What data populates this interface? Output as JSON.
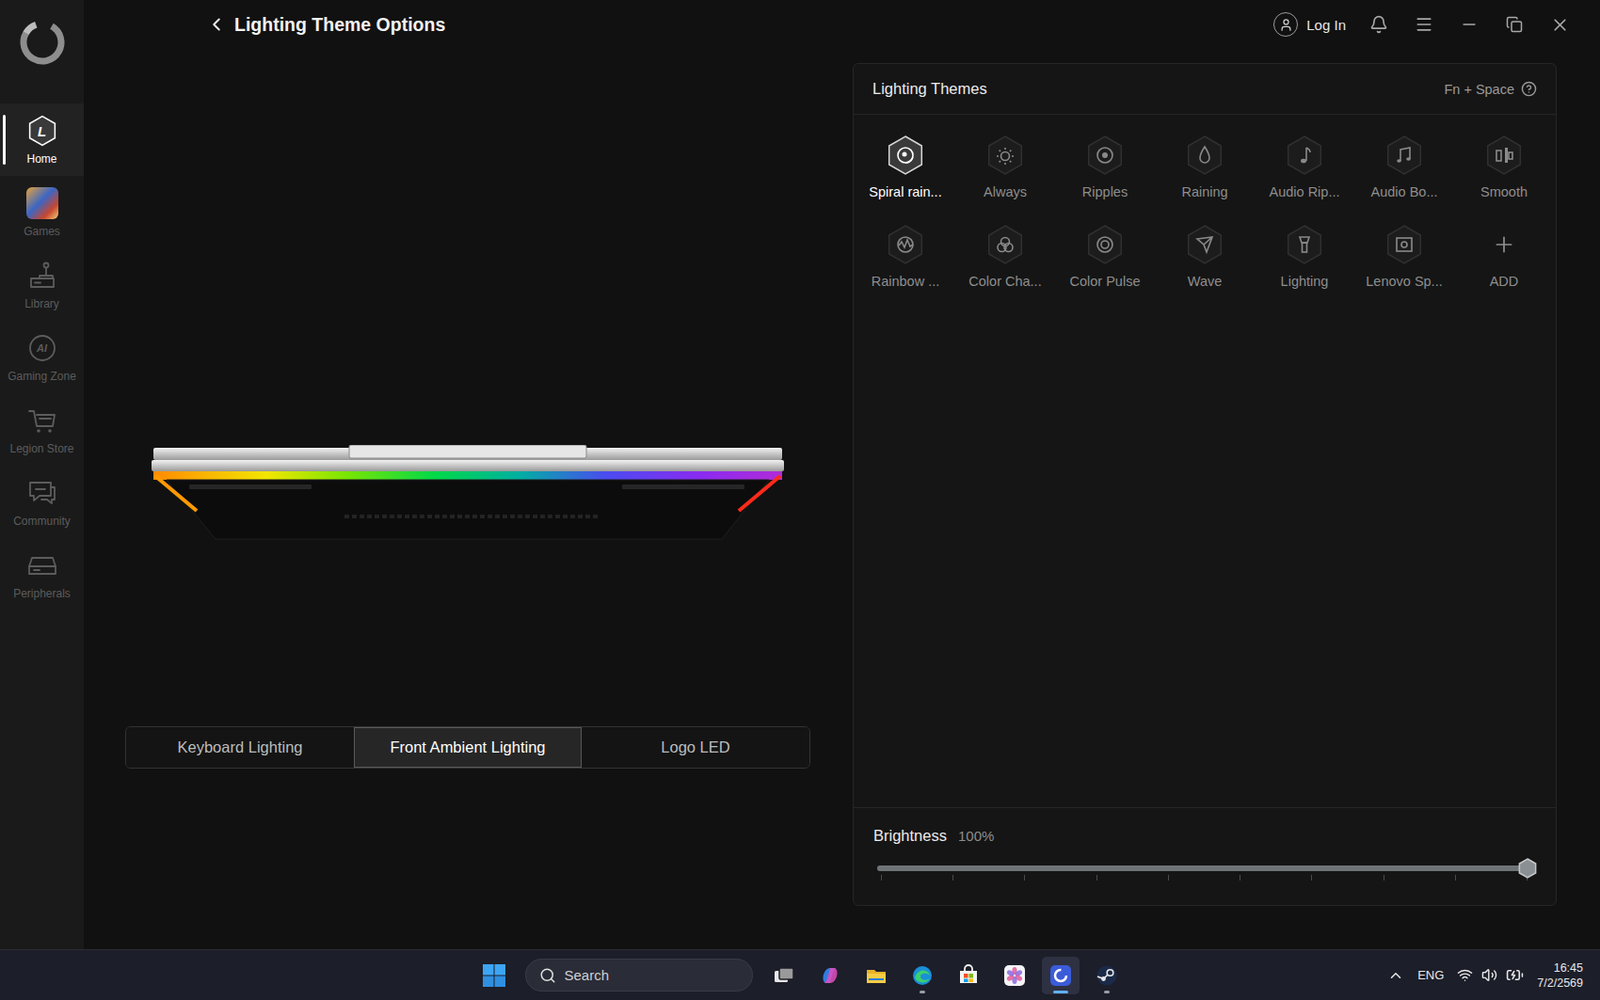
{
  "window": {
    "title": "Lighting Theme Options"
  },
  "header": {
    "login": "Log In"
  },
  "sidebar": {
    "items": [
      {
        "label": "Home",
        "selected": true,
        "badge": "L"
      },
      {
        "label": "Games",
        "selected": false
      },
      {
        "label": "Library",
        "selected": false
      },
      {
        "label": "Gaming Zone",
        "selected": false,
        "badge": "AI"
      },
      {
        "label": "Legion Store",
        "selected": false
      },
      {
        "label": "Community",
        "selected": false
      },
      {
        "label": "Peripherals",
        "selected": false
      }
    ]
  },
  "zone_tabs": [
    {
      "label": "Keyboard Lighting",
      "selected": false
    },
    {
      "label": "Front Ambient Lighting",
      "selected": true
    },
    {
      "label": "Logo LED",
      "selected": false
    }
  ],
  "themes_panel": {
    "title": "Lighting Themes",
    "shortcut": "Fn + Space",
    "themes": [
      {
        "label": "Spiral rain...",
        "selected": true,
        "kind": "theme"
      },
      {
        "label": "Always",
        "selected": false,
        "kind": "theme"
      },
      {
        "label": "Ripples",
        "selected": false,
        "kind": "theme"
      },
      {
        "label": "Raining",
        "selected": false,
        "kind": "theme"
      },
      {
        "label": "Audio Rip...",
        "selected": false,
        "kind": "theme"
      },
      {
        "label": "Audio Bo...",
        "selected": false,
        "kind": "theme"
      },
      {
        "label": "Smooth",
        "selected": false,
        "kind": "theme"
      },
      {
        "label": "Rainbow ...",
        "selected": false,
        "kind": "theme"
      },
      {
        "label": "Color Cha...",
        "selected": false,
        "kind": "theme"
      },
      {
        "label": "Color Pulse",
        "selected": false,
        "kind": "theme"
      },
      {
        "label": "Wave",
        "selected": false,
        "kind": "theme"
      },
      {
        "label": "Lighting",
        "selected": false,
        "kind": "theme"
      },
      {
        "label": "Lenovo Sp...",
        "selected": false,
        "kind": "theme"
      },
      {
        "label": "ADD",
        "selected": false,
        "kind": "add"
      }
    ]
  },
  "brightness": {
    "label": "Brightness",
    "reading": "100%",
    "level": 1
  },
  "taskbar": {
    "search_placeholder": "Search",
    "apps": [
      {
        "running": false,
        "active": false
      },
      {
        "running": false,
        "active": false
      },
      {
        "running": false,
        "active": false
      },
      {
        "running": true,
        "active": false
      },
      {
        "running": false,
        "active": false
      },
      {
        "running": false,
        "active": false
      },
      {
        "running": true,
        "active": true
      },
      {
        "running": true,
        "active": false
      }
    ],
    "tray": {
      "language": "ENG",
      "time": "16:45",
      "date": "7/2/2569"
    }
  }
}
